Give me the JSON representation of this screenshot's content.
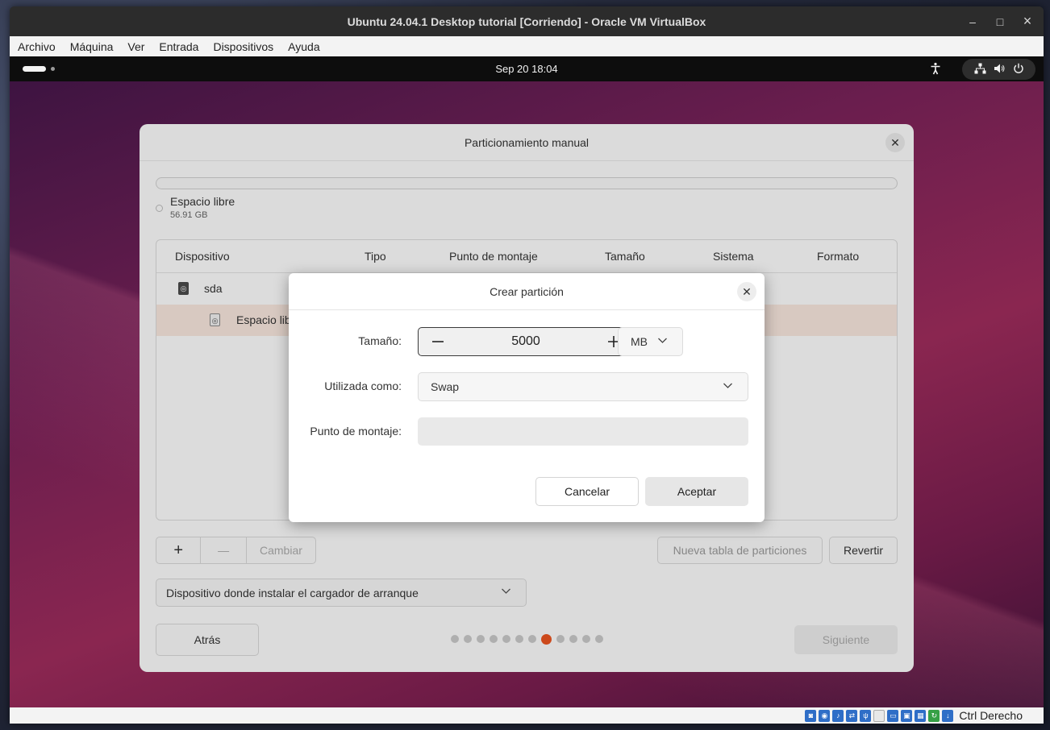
{
  "vbox": {
    "title": "Ubuntu 24.04.1 Desktop tutorial [Corriendo] - Oracle VM VirtualBox",
    "menu": [
      "Archivo",
      "Máquina",
      "Ver",
      "Entrada",
      "Dispositivos",
      "Ayuda"
    ],
    "host_key": "Ctrl Derecho",
    "window_controls": {
      "minimize": "–",
      "maximize": "□",
      "close": "×"
    }
  },
  "gnome": {
    "clock": "Sep 20  18:04",
    "icons": {
      "accessibility": "accessibility-icon",
      "network": "network-icon",
      "volume": "volume-icon",
      "power": "power-icon"
    }
  },
  "installer": {
    "title": "Particionamiento manual",
    "free_space_label": "Espacio libre",
    "free_space_size": "56.91 GB",
    "table": {
      "columns": [
        "Dispositivo",
        "Tipo",
        "Punto de montaje",
        "Tamaño",
        "Sistema",
        "Formato"
      ],
      "rows": [
        {
          "device": "sda"
        },
        {
          "device": "Espacio lib"
        }
      ]
    },
    "toolbar": {
      "add": "+",
      "remove": "—",
      "change": "Cambiar"
    },
    "new_table_label": "Nueva tabla de particiones",
    "revert_label": "Revertir",
    "bootloader_placeholder": "Dispositivo donde instalar el cargador de arranque",
    "back_label": "Atrás",
    "next_label": "Siguiente",
    "progress": {
      "total_steps": 12,
      "current_step": 8
    },
    "accent_color": "#e95420"
  },
  "dialog": {
    "title": "Crear partición",
    "size_label": "Tamaño:",
    "size_value": "5000",
    "size_minus": "−",
    "size_plus": "+",
    "unit": "MB",
    "used_as_label": "Utilizada como:",
    "used_as_value": "Swap",
    "mount_label": "Punto de montaje:",
    "mount_value": "",
    "cancel_label": "Cancelar",
    "ok_label": "Aceptar"
  }
}
